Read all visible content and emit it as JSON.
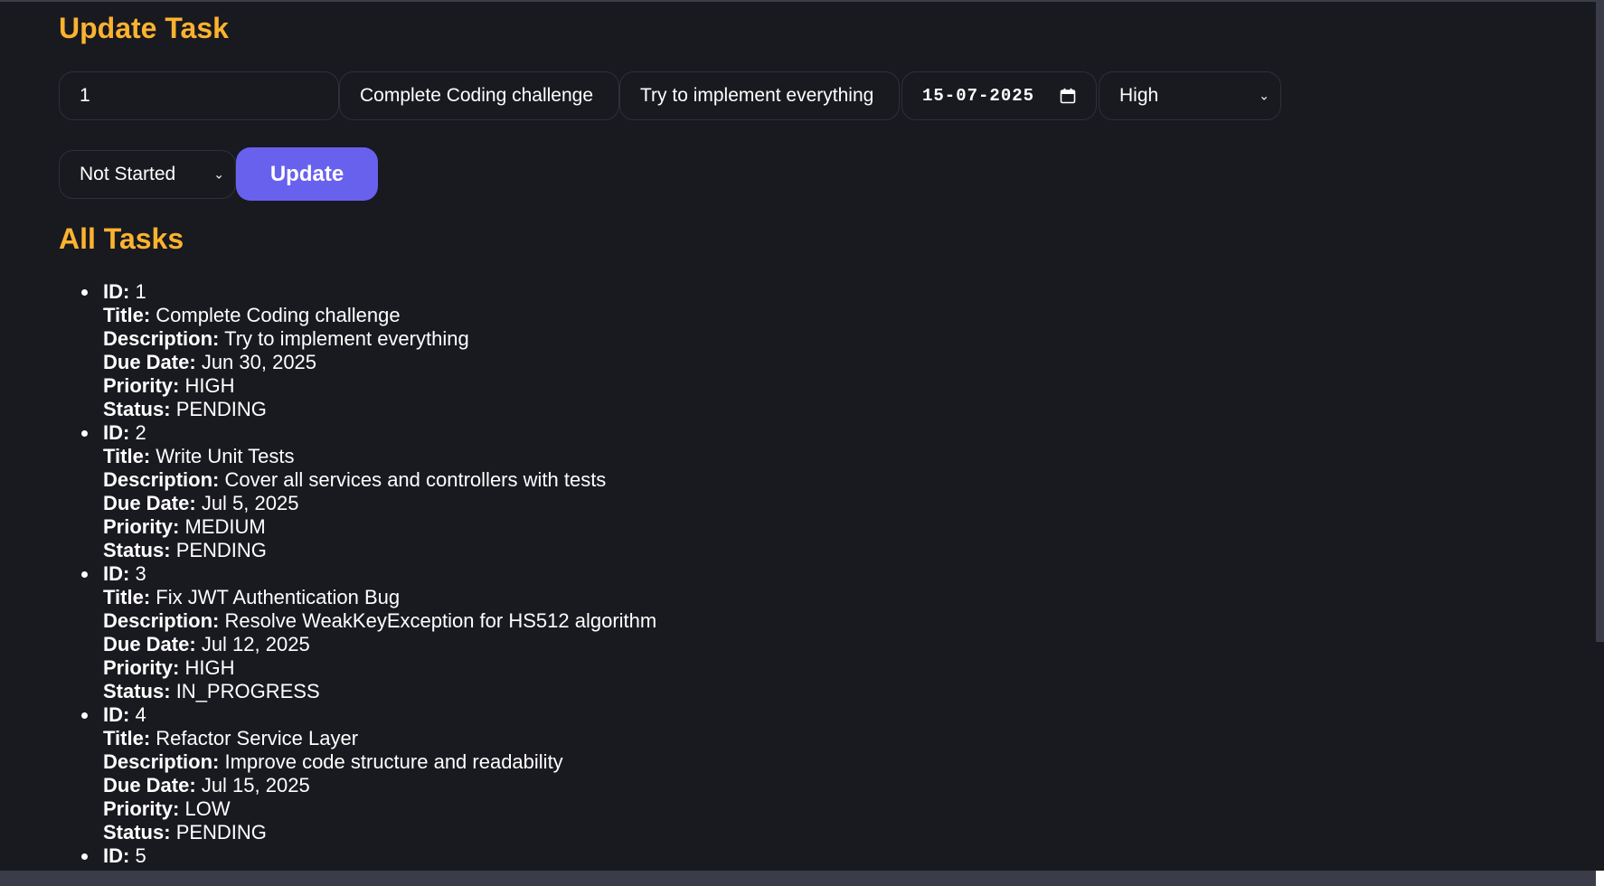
{
  "update_section": {
    "title": "Update Task",
    "id_value": "1",
    "title_value": "Complete Coding challenge",
    "description_value": "Try to implement everything",
    "due_date_value": "15-07-2025",
    "priority_selected": "High",
    "status_selected": "Not Started",
    "update_label": "Update"
  },
  "tasks_section": {
    "title": "All Tasks",
    "labels": {
      "id": "ID:",
      "title": "Title:",
      "description": "Description:",
      "due_date": "Due Date:",
      "priority": "Priority:",
      "status": "Status:"
    },
    "tasks": [
      {
        "id": "1",
        "title": "Complete Coding challenge",
        "description": "Try to implement everything",
        "due_date": "Jun 30, 2025",
        "priority": "HIGH",
        "status": "PENDING"
      },
      {
        "id": "2",
        "title": "Write Unit Tests",
        "description": "Cover all services and controllers with tests",
        "due_date": "Jul 5, 2025",
        "priority": "MEDIUM",
        "status": "PENDING"
      },
      {
        "id": "3",
        "title": "Fix JWT Authentication Bug",
        "description": "Resolve WeakKeyException for HS512 algorithm",
        "due_date": "Jul 12, 2025",
        "priority": "HIGH",
        "status": "IN_PROGRESS"
      },
      {
        "id": "4",
        "title": "Refactor Service Layer",
        "description": "Improve code structure and readability",
        "due_date": "Jul 15, 2025",
        "priority": "LOW",
        "status": "PENDING"
      },
      {
        "id": "5"
      }
    ]
  },
  "icons": {
    "calendar": "calendar-icon",
    "chevron": "chevron-down-icon"
  },
  "colors": {
    "background": "#191920",
    "heading": "#fbb32f",
    "button": "#6861ee",
    "text": "#ffffff",
    "field_border": "#2f3038"
  }
}
